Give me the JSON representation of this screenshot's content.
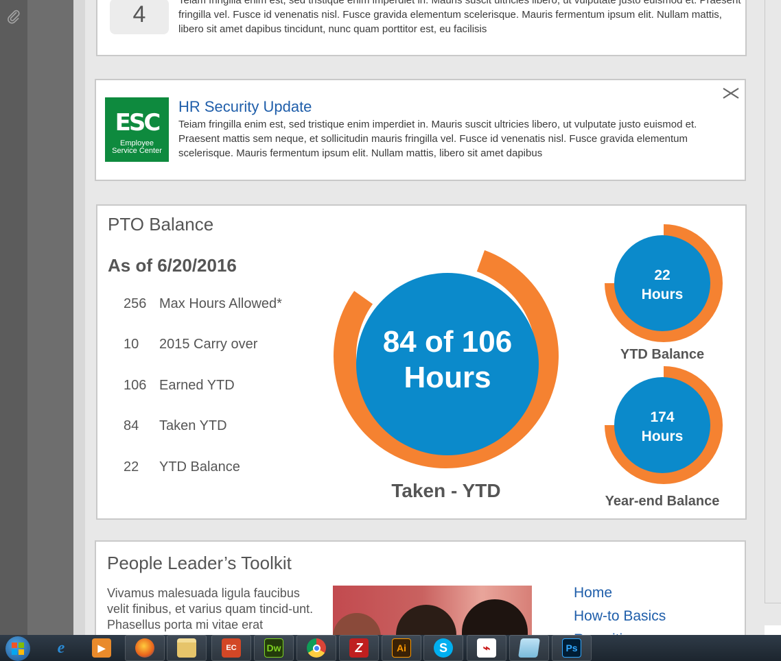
{
  "top_card": {
    "number": "4",
    "text": "Teiam fringilla enim est, sed tristique enim imperdiet in. Mauris suscit ultricies libero, ut vulputate justo euismod et. Praesent fringilla vel. Fusce id venenatis nisl. Fusce gravida elementum scelerisque. Mauris fermentum ipsum elit. Nullam mattis, libero sit amet dapibus tincidunt, nunc quam porttitor est, eu facilisis"
  },
  "hr_card": {
    "logo_big": "ESC",
    "logo_small_1": "Employee",
    "logo_small_2": "Service Center",
    "title": "HR Security Update",
    "text": "Teiam fringilla enim est, sed tristique enim imperdiet in. Mauris suscit ultricies libero, ut vulputate justo euismod et. Praesent mattis sem neque, et sollicitudin mauris fringilla vel. Fusce id venenatis nisl. Fusce gravida elementum scelerisque. Mauris fermentum ipsum elit. Nullam mattis, libero sit amet dapibus",
    "close_label": "✕"
  },
  "pto": {
    "title": "PTO Balance",
    "as_of": "As of 6/20/2016",
    "rows": [
      {
        "value": "256",
        "label": "Max Hours Allowed*"
      },
      {
        "value": "10",
        "label": "2015 Carry over"
      },
      {
        "value": "106",
        "label": "Earned YTD"
      },
      {
        "value": "84",
        "label": "Taken YTD"
      },
      {
        "value": "22",
        "label": "YTD Balance"
      }
    ],
    "colors": {
      "ring": "#f58231",
      "circle": "#0b8acb"
    }
  },
  "chart_data": [
    {
      "type": "gauge",
      "center_line1": "84 of 106",
      "center_line2": "Hours",
      "caption": "Taken - YTD",
      "value": 84,
      "max": 106
    },
    {
      "type": "gauge",
      "center_line1": "22",
      "center_line2": "Hours",
      "caption": "YTD Balance",
      "value": 0.75,
      "max": 1
    },
    {
      "type": "gauge",
      "center_line1": "174",
      "center_line2": "Hours",
      "caption": "Year-end Balance",
      "value": 0.75,
      "max": 1
    }
  ],
  "toolkit": {
    "title": "People Leader’s Toolkit",
    "text": "Vivamus malesuada ligula faucibus velit finibus, et varius quam tincid-unt. Phasellus porta mi vitae erat",
    "links": [
      "Home",
      "How-to Basics",
      "Recruiting"
    ]
  },
  "taskbar": {
    "icons": [
      "windows-start-icon",
      "internet-explorer-icon",
      "media-player-icon",
      "firefox-icon",
      "file-explorer-icon",
      "powerpoint-icon",
      "dreamweaver-icon",
      "chrome-icon",
      "filezilla-icon",
      "illustrator-icon",
      "skype-icon",
      "acrobat-icon",
      "notepad-icon",
      "photoshop-icon"
    ],
    "labels": {
      "dw": "Dw",
      "ai": "Ai",
      "ps": "Ps",
      "fz": "Z",
      "skype": "S"
    }
  }
}
